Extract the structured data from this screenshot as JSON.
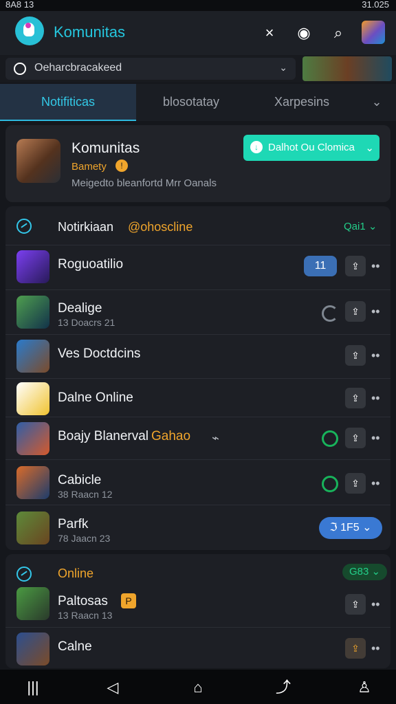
{
  "status": {
    "left_text": "8A8 13",
    "right_text": "31.025"
  },
  "header": {
    "title": "Komunitas",
    "close_label": "×",
    "badge_label": "◉",
    "search_label": "⌕"
  },
  "selector": {
    "value": "Oeharcbracakeed",
    "chevron": "⌄"
  },
  "tabs": [
    "Notifiticas",
    "blosotatay",
    "Xarpesins",
    "⌄"
  ],
  "hero": {
    "title": "Komunitas",
    "subtitle": "Bamety",
    "description": "Meigedto bleanfortd Mrr Oanals",
    "cta": "Dalhot Ou Clomica",
    "cta_chevron": "⌄"
  },
  "section_one": {
    "title": "Notirkiaan",
    "accent": "@ohoscline",
    "count": "Qai1 ⌄",
    "rows": [
      {
        "title": "Roguoatilio",
        "subtitle": "",
        "badge": "11",
        "status": "",
        "accent": "",
        "pill": "",
        "icon": "purple-game-icon"
      },
      {
        "title": "Dealige",
        "subtitle": "13 Doacrs 21",
        "badge": "",
        "status": "partial",
        "accent": "",
        "pill": "",
        "icon": "green-game-icon"
      },
      {
        "title": "Ves Doctdcins",
        "subtitle": "",
        "badge": "",
        "status": "",
        "accent": "",
        "pill": "",
        "icon": "blue-game-icon"
      },
      {
        "title": "Dalne Online",
        "subtitle": "",
        "badge": "",
        "status": "",
        "accent": "",
        "pill": "",
        "icon": "white-game-icon"
      },
      {
        "title": "Boajy Blanerval",
        "subtitle": "",
        "badge": "",
        "status": "online",
        "accent": "Gahao",
        "pill": "",
        "icon": "orange-game-icon"
      },
      {
        "title": "Cabicle",
        "subtitle": "38 Raacn 12",
        "badge": "",
        "status": "online",
        "accent": "",
        "pill": "",
        "icon": "brown-game-icon"
      },
      {
        "title": "Parfk",
        "subtitle": "78 Jaacn 23",
        "badge": "",
        "status": "",
        "accent": "",
        "pill": "ℑ 1F5 ⌄",
        "icon": "forest-game-icon"
      }
    ]
  },
  "section_two": {
    "title": "Online",
    "count": "G83 ⌄",
    "rows": [
      {
        "title": "Paltosas",
        "subtitle": "13 Raacn 13",
        "flag": "P",
        "icon": "green-brown-icon"
      },
      {
        "title": "Calne",
        "subtitle": "",
        "flag": "",
        "icon": "blue-orange-icon"
      }
    ]
  },
  "nav": [
    "|||",
    "◁",
    "⌂",
    "⤴",
    "♙"
  ]
}
